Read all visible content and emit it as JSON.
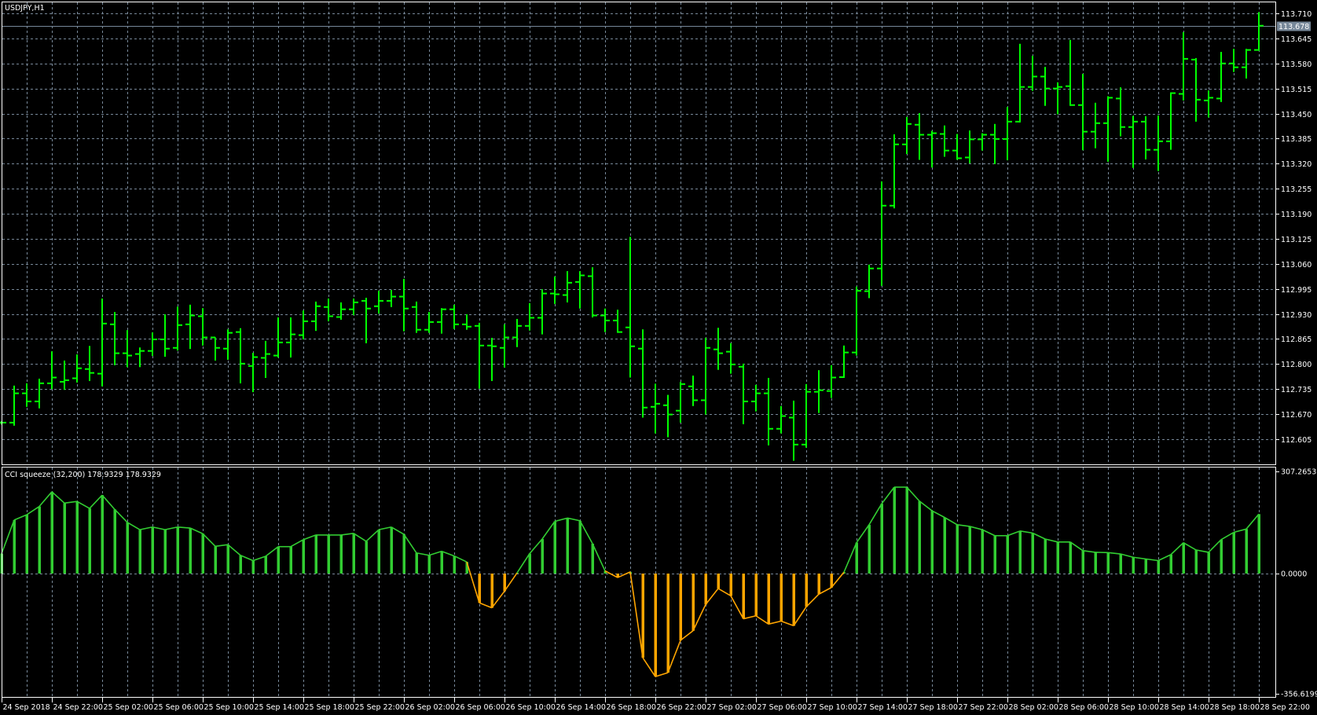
{
  "window": {
    "title": "USDJPY,H1"
  },
  "indicator": {
    "label": "CCI squeeze (32,200) 178.9329 178.9329"
  },
  "colors": {
    "bars": "#00ff00",
    "cci_up": "#32cd32",
    "cci_down": "#ffa500",
    "grid": "#778899",
    "axis": "#ffffff",
    "background": "#000000"
  },
  "price_axis": {
    "labels": [
      "113.710",
      "113.645",
      "113.580",
      "113.515",
      "113.450",
      "113.385",
      "113.320",
      "113.255",
      "113.190",
      "113.125",
      "113.060",
      "112.995",
      "112.930",
      "112.865",
      "112.800",
      "112.735",
      "112.670",
      "112.605"
    ],
    "current_price": "113.678"
  },
  "indicator_axis": {
    "labels": [
      "307.2653",
      "0.0000",
      "-356.6199"
    ]
  },
  "time_axis": {
    "labels": [
      "24 Sep 2018",
      "24 Sep 22:00",
      "25 Sep 02:00",
      "25 Sep 06:00",
      "25 Sep 10:00",
      "25 Sep 14:00",
      "25 Sep 18:00",
      "25 Sep 22:00",
      "26 Sep 02:00",
      "26 Sep 06:00",
      "26 Sep 10:00",
      "26 Sep 14:00",
      "26 Sep 18:00",
      "26 Sep 22:00",
      "27 Sep 02:00",
      "27 Sep 06:00",
      "27 Sep 10:00",
      "27 Sep 14:00",
      "27 Sep 18:00",
      "27 Sep 22:00",
      "28 Sep 02:00",
      "28 Sep 06:00",
      "28 Sep 10:00",
      "28 Sep 14:00",
      "28 Sep 18:00",
      "28 Sep 22:00"
    ]
  },
  "chart_data": [
    {
      "type": "ohlc",
      "title": "USDJPY,H1",
      "ylim": [
        112.605,
        113.71
      ],
      "current_price": 113.678,
      "x_start": "24 Sep 2018 18:00",
      "x_end": "28 Sep 22:00",
      "grid": true,
      "ohlc": [
        [
          112.648,
          112.652,
          112.645,
          112.648
        ],
        [
          112.648,
          112.744,
          112.642,
          112.724
        ],
        [
          112.724,
          112.75,
          112.691,
          112.703
        ],
        [
          112.703,
          112.762,
          112.687,
          112.75
        ],
        [
          112.75,
          112.833,
          112.737,
          112.765
        ],
        [
          112.754,
          112.809,
          112.735,
          112.758
        ],
        [
          112.763,
          112.825,
          112.754,
          112.789
        ],
        [
          112.787,
          112.847,
          112.758,
          112.777
        ],
        [
          112.775,
          112.97,
          112.744,
          112.905
        ],
        [
          112.903,
          112.935,
          112.799,
          112.828
        ],
        [
          112.828,
          112.888,
          112.794,
          112.822
        ],
        [
          112.826,
          112.843,
          112.794,
          112.834
        ],
        [
          112.834,
          112.882,
          112.823,
          112.864
        ],
        [
          112.864,
          112.929,
          112.821,
          112.84
        ],
        [
          112.842,
          112.949,
          112.837,
          112.901
        ],
        [
          112.903,
          112.954,
          112.841,
          112.926
        ],
        [
          112.924,
          112.945,
          112.85,
          112.869
        ],
        [
          112.869,
          112.869,
          112.811,
          112.842
        ],
        [
          112.84,
          112.89,
          112.813,
          112.881
        ],
        [
          112.883,
          112.893,
          112.752,
          112.801
        ],
        [
          112.795,
          112.829,
          112.729,
          112.818
        ],
        [
          112.816,
          112.86,
          112.766,
          112.826
        ],
        [
          112.822,
          112.921,
          112.819,
          112.856
        ],
        [
          112.856,
          112.921,
          112.819,
          112.877
        ],
        [
          112.875,
          112.939,
          112.866,
          112.911
        ],
        [
          112.911,
          112.962,
          112.888,
          112.95
        ],
        [
          112.948,
          112.97,
          112.913,
          112.924
        ],
        [
          112.922,
          112.96,
          112.917,
          112.942
        ],
        [
          112.942,
          112.97,
          112.929,
          112.96
        ],
        [
          112.964,
          112.972,
          112.856,
          112.944
        ],
        [
          112.95,
          112.99,
          112.933,
          112.964
        ],
        [
          112.964,
          112.992,
          112.95,
          112.975
        ],
        [
          112.975,
          113.021,
          112.887,
          112.944
        ],
        [
          112.948,
          112.962,
          112.883,
          112.889
        ],
        [
          112.889,
          112.935,
          112.883,
          112.909
        ],
        [
          112.909,
          112.945,
          112.881,
          112.942
        ],
        [
          112.942,
          112.954,
          112.893,
          112.903
        ],
        [
          112.903,
          112.929,
          112.891,
          112.897
        ],
        [
          112.899,
          112.907,
          112.738,
          112.848
        ],
        [
          112.848,
          112.868,
          112.758,
          112.846
        ],
        [
          112.842,
          112.903,
          112.793,
          112.869
        ],
        [
          112.869,
          112.917,
          112.846,
          112.899
        ],
        [
          112.899,
          112.958,
          112.889,
          112.92
        ],
        [
          112.92,
          112.994,
          112.879,
          112.983
        ],
        [
          112.983,
          113.027,
          112.958,
          112.981
        ],
        [
          112.979,
          113.041,
          112.962,
          113.011
        ],
        [
          113.013,
          113.041,
          112.946,
          113.03
        ],
        [
          113.028,
          113.051,
          112.923,
          112.926
        ],
        [
          112.926,
          112.944,
          112.885,
          112.913
        ],
        [
          112.913,
          112.941,
          112.883,
          112.883
        ],
        [
          112.895,
          113.13,
          112.767,
          112.846
        ],
        [
          112.84,
          112.89,
          112.663,
          112.687
        ],
        [
          112.689,
          112.749,
          112.622,
          112.697
        ],
        [
          112.693,
          112.72,
          112.612,
          112.669
        ],
        [
          112.679,
          112.754,
          112.65,
          112.748
        ],
        [
          112.742,
          112.77,
          112.693,
          112.706
        ],
        [
          112.706,
          112.868,
          112.671,
          112.842
        ],
        [
          112.838,
          112.894,
          112.787,
          112.828
        ],
        [
          112.832,
          112.854,
          112.777,
          112.799
        ],
        [
          112.793,
          112.801,
          112.646,
          112.703
        ],
        [
          112.703,
          112.746,
          112.679,
          112.724
        ],
        [
          112.724,
          112.764,
          112.591,
          112.632
        ],
        [
          112.632,
          112.691,
          112.622,
          112.665
        ],
        [
          112.661,
          112.705,
          112.551,
          112.591
        ],
        [
          112.591,
          112.748,
          112.585,
          112.728
        ],
        [
          112.728,
          112.784,
          112.675,
          112.732
        ],
        [
          112.73,
          112.797,
          112.714,
          112.765
        ],
        [
          112.766,
          112.848,
          112.766,
          112.83
        ],
        [
          112.83,
          113.001,
          112.824,
          112.99
        ],
        [
          112.989,
          113.058,
          112.973,
          113.048
        ],
        [
          113.048,
          113.274,
          113.005,
          113.211
        ],
        [
          113.211,
          113.396,
          113.206,
          113.37
        ],
        [
          113.37,
          113.441,
          113.347,
          113.423
        ],
        [
          113.421,
          113.451,
          113.332,
          113.395
        ],
        [
          113.395,
          113.405,
          113.312,
          113.399
        ],
        [
          113.397,
          113.419,
          113.34,
          113.354
        ],
        [
          113.354,
          113.397,
          113.332,
          113.334
        ],
        [
          113.336,
          113.406,
          113.323,
          113.383
        ],
        [
          113.383,
          113.399,
          113.356,
          113.395
        ],
        [
          113.395,
          113.423,
          113.321,
          113.384
        ],
        [
          113.384,
          113.467,
          113.331,
          113.429
        ],
        [
          113.429,
          113.631,
          113.429,
          113.519
        ],
        [
          113.519,
          113.6,
          113.511,
          113.546
        ],
        [
          113.546,
          113.571,
          113.472,
          113.515
        ],
        [
          113.515,
          113.531,
          113.45,
          113.519
        ],
        [
          113.521,
          113.641,
          113.472,
          113.472
        ],
        [
          113.472,
          113.553,
          113.357,
          113.403
        ],
        [
          113.403,
          113.478,
          113.362,
          113.425
        ],
        [
          113.425,
          113.495,
          113.327,
          113.491
        ],
        [
          113.489,
          113.518,
          113.393,
          113.415
        ],
        [
          113.415,
          113.444,
          113.311,
          113.429
        ],
        [
          113.429,
          113.443,
          113.333,
          113.356
        ],
        [
          113.356,
          113.445,
          113.303,
          113.378
        ],
        [
          113.378,
          113.505,
          113.358,
          113.503
        ],
        [
          113.501,
          113.661,
          113.486,
          113.592
        ],
        [
          113.59,
          113.594,
          113.431,
          113.486
        ],
        [
          113.484,
          113.51,
          113.442,
          113.491
        ],
        [
          113.489,
          113.61,
          113.482,
          113.58
        ],
        [
          113.58,
          113.618,
          113.56,
          113.57
        ],
        [
          113.57,
          113.618,
          113.543,
          113.615
        ],
        [
          113.615,
          113.713,
          113.615,
          113.678
        ]
      ]
    },
    {
      "type": "bar",
      "title": "CCI squeeze (32,200)",
      "ylim": [
        -356.6199,
        307.2653
      ],
      "values": [
        60,
        161,
        177,
        202,
        246,
        212,
        217,
        196,
        236,
        193,
        154,
        132,
        140,
        132,
        140,
        137,
        120,
        82,
        87,
        55,
        39,
        52,
        81,
        81,
        102,
        116,
        116,
        116,
        121,
        97,
        132,
        140,
        118,
        62,
        55,
        67,
        53,
        35,
        -88,
        -103,
        -53,
        2,
        60,
        104,
        157,
        167,
        159,
        90,
        8,
        -12,
        5,
        -253,
        -310,
        -298,
        -201,
        -172,
        -93,
        -45,
        -67,
        -136,
        -127,
        -152,
        -143,
        -157,
        -100,
        -62,
        -42,
        4,
        93,
        147,
        210,
        260,
        260,
        218,
        189,
        169,
        147,
        142,
        132,
        114,
        114,
        128,
        122,
        104,
        95,
        95,
        69,
        64,
        63,
        59,
        49,
        44,
        39,
        57,
        93,
        71,
        64,
        102,
        124,
        134,
        178.9329
      ]
    }
  ]
}
